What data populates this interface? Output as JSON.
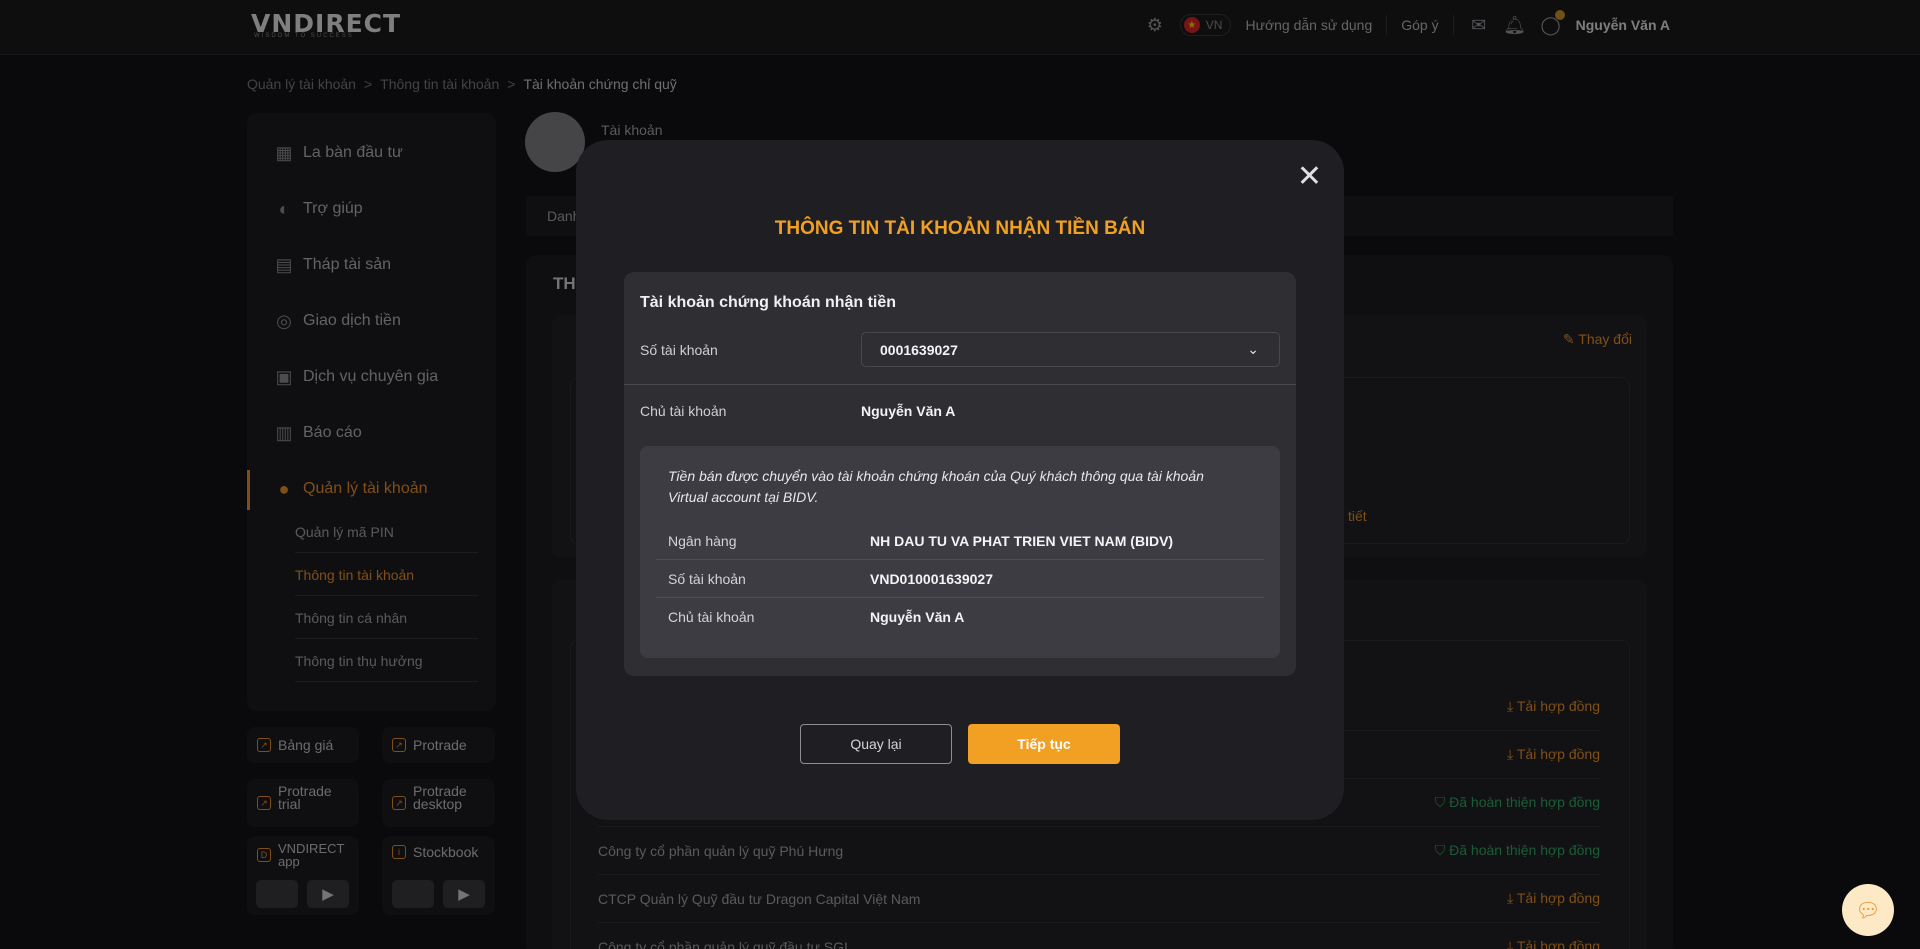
{
  "header": {
    "logo": "VNDIRECT",
    "logo_tagline": "WISDOM TO SUCCESS",
    "lang": "VN",
    "guide": "Hướng dẫn sử dụng",
    "feedback": "Góp ý",
    "user": "Nguyễn Văn A"
  },
  "breadcrumb": [
    "Quản lý tài khoản",
    ">",
    "Thông tin tài khoản",
    ">",
    "Tài khoản chứng chỉ quỹ"
  ],
  "sidebar": {
    "items": [
      {
        "label": "La bàn đầu tư",
        "icon": "compass-icon"
      },
      {
        "label": "Trợ giúp",
        "icon": "help-icon"
      },
      {
        "label": "Tháp tài sản",
        "icon": "tower-icon"
      },
      {
        "label": "Giao dịch tiền",
        "icon": "money-icon"
      },
      {
        "label": "Dịch vụ chuyên gia",
        "icon": "expert-icon"
      },
      {
        "label": "Báo cáo",
        "icon": "report-icon"
      },
      {
        "label": "Quản lý tài khoản",
        "icon": "user-icon"
      }
    ],
    "sub_items": [
      "Quản lý mã PIN",
      "Thông tin tài khoản",
      "Thông tin cá nhân",
      "Thông tin thụ hưởng"
    ],
    "tiles": [
      "Bảng giá",
      "Protrade",
      "Protrade trial",
      "Protrade desktop",
      "VNDIRECT app",
      "Stockbook"
    ]
  },
  "background": {
    "account_label": "Tài khoản",
    "tab_partial": "Danh",
    "section_partial": "TH",
    "change_link": "Thay đổi",
    "detail_partial": "tiết",
    "rows": [
      {
        "name": "",
        "action": "Tải hợp đồng",
        "status": "download"
      },
      {
        "name": "",
        "action": "Tải hợp đồng",
        "status": "download"
      },
      {
        "name": "",
        "action": "Đã hoàn thiện hợp đồng",
        "status": "done"
      },
      {
        "name": "Công ty cổ phần quản lý quỹ Phú Hưng",
        "action": "Đã hoàn thiện hợp đồng",
        "status": "done"
      },
      {
        "name": "CTCP Quản lý Quỹ đầu tư Dragon Capital Việt Nam",
        "action": "Tải hợp đồng",
        "status": "download"
      },
      {
        "name": "Công ty cổ phần quản lý quỹ đầu tư SGI",
        "action": "Tải hợp đồng",
        "status": "download"
      }
    ]
  },
  "modal": {
    "title": "THÔNG TIN TÀI KHOẢN NHẬN TIỀN BÁN",
    "card_title": "Tài khoản chứng khoán nhận tiền",
    "account_label": "Số tài khoản",
    "account_value": "0001639027",
    "owner_label": "Chủ tài khoản",
    "owner_value": "Nguyễn Văn A",
    "note": "Tiền bán được chuyển vào tài khoản chứng khoán của Quý khách thông qua tài khoản Virtual account tại BIDV.",
    "bank_rows": [
      {
        "label": "Ngân hàng",
        "value": "NH DAU TU VA PHAT TRIEN VIET NAM (BIDV)"
      },
      {
        "label": "Số tài khoản",
        "value": "VND010001639027"
      },
      {
        "label": "Chủ tài khoản",
        "value": "Nguyễn Văn A"
      }
    ],
    "back_label": "Quay lại",
    "next_label": "Tiếp tục"
  },
  "colors": {
    "accent": "#f2a024",
    "success": "#2fa864",
    "bg": "#131316"
  }
}
